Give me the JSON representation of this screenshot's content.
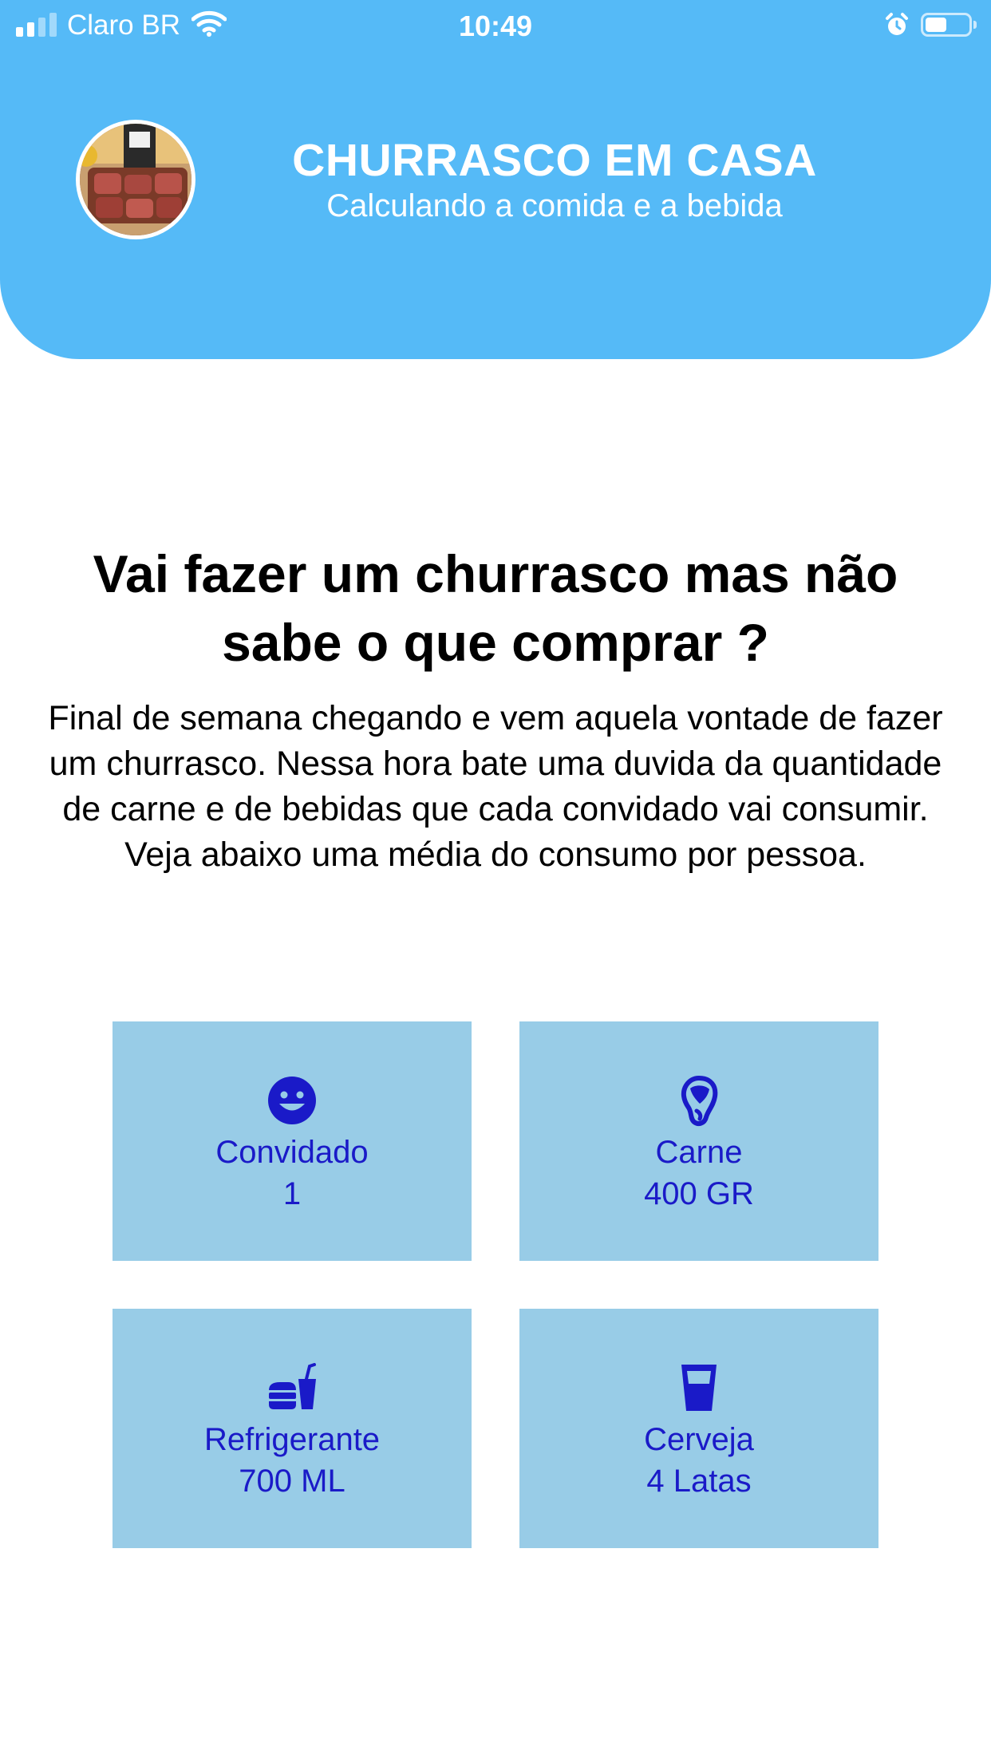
{
  "status_bar": {
    "carrier": "Claro BR",
    "time": "10:49"
  },
  "header": {
    "title": "CHURRASCO EM CASA",
    "subtitle": "Calculando a comida e a bebida"
  },
  "main": {
    "headline": "Vai fazer um churrasco mas não sabe o que comprar ?",
    "description": "Final de semana chegando e vem aquela vontade de fazer um churrasco. Nessa hora bate uma duvida da quantidade de carne e de bebidas que cada convidado vai consumir. Veja abaixo uma média do consumo por pessoa."
  },
  "cards": [
    {
      "label": "Convidado",
      "value": "1",
      "icon": "smiley-icon"
    },
    {
      "label": "Carne",
      "value": "400 GR",
      "icon": "meat-icon"
    },
    {
      "label": "Refrigerante",
      "value": "700 ML",
      "icon": "fastfood-icon"
    },
    {
      "label": "Cerveja",
      "value": "4 Latas",
      "icon": "glass-icon"
    }
  ],
  "colors": {
    "header_bg": "#55baf7",
    "card_bg": "#98cce7",
    "card_text": "#1a1ac8"
  }
}
